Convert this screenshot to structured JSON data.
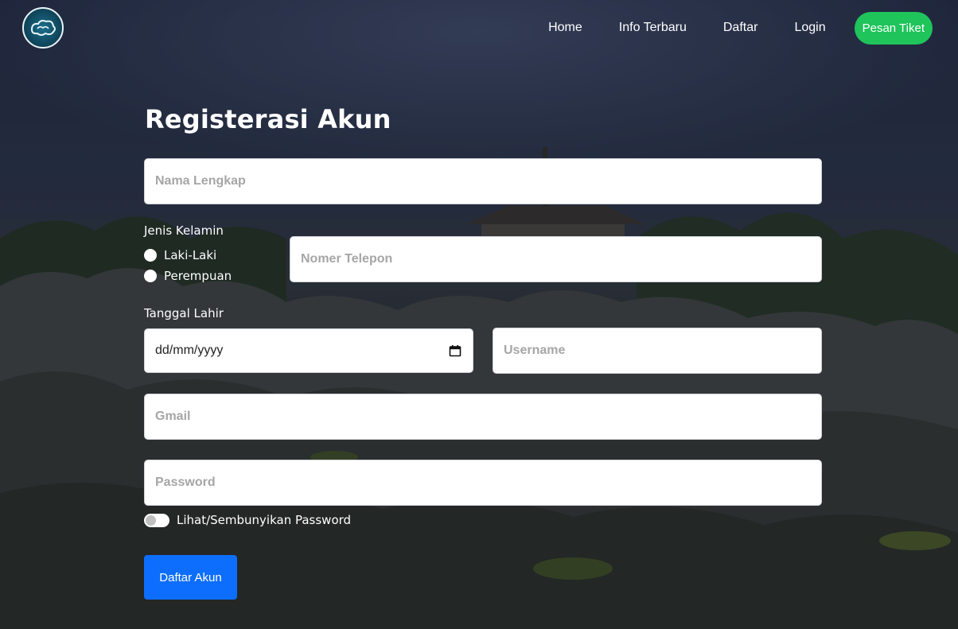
{
  "nav": {
    "logo_icon": "batik-cloud-logo",
    "links": [
      "Home",
      "Info Terbaru",
      "Daftar",
      "Login"
    ],
    "cta_label": "Pesan Tiket",
    "cta_color": "#1fc45b"
  },
  "form": {
    "title": "Registerasi Akun",
    "full_name": {
      "placeholder": "Nama Lengkap",
      "value": ""
    },
    "gender": {
      "label": "Jenis Kelamin",
      "options": [
        "Laki-Laki",
        "Perempuan"
      ]
    },
    "phone": {
      "placeholder": "Nomer Telepon",
      "value": ""
    },
    "birth_date": {
      "label": "Tanggal Lahir",
      "placeholder": "dd/mm/yyyy"
    },
    "username": {
      "placeholder": "Username",
      "value": ""
    },
    "gmail": {
      "placeholder": "Gmail",
      "value": ""
    },
    "password": {
      "placeholder": "Password",
      "value": ""
    },
    "show_password_label": "Lihat/Sembunyikan Password",
    "submit_label": "Daftar Akun",
    "submit_color": "#0d6efd"
  }
}
